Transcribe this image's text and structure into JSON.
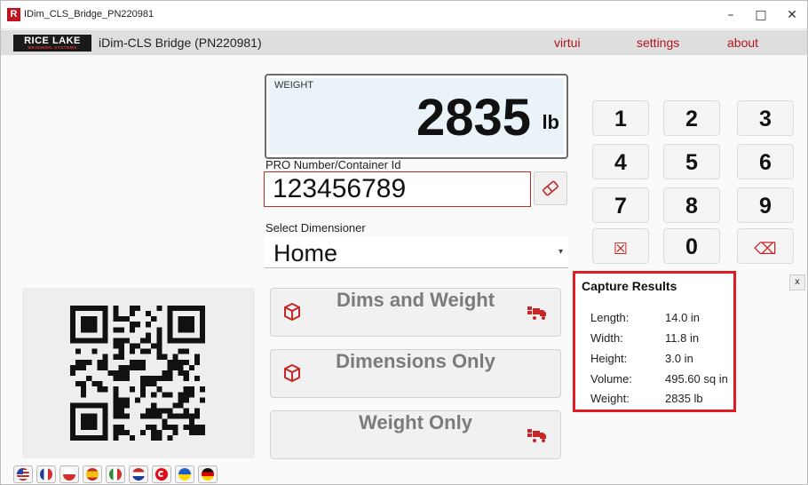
{
  "window": {
    "title": "IDim_CLS_Bridge_PN220981",
    "icon_glyph": "R",
    "controls": {
      "minimize": "–",
      "maximize": "□",
      "close": "✕"
    }
  },
  "header": {
    "brand_top": "RICE LAKE",
    "brand_bottom": "WEIGHING SYSTEMS",
    "title": "iDim-CLS Bridge (PN220981)",
    "menu": [
      "virtui",
      "settings",
      "about"
    ],
    "accent_color": "#b3141c"
  },
  "weight": {
    "label": "WEIGHT",
    "value": "2835",
    "unit": "lb"
  },
  "pro": {
    "label": "PRO Number/Container Id",
    "value": "123456789",
    "clear_icon": "eraser-icon"
  },
  "dimensioner": {
    "label": "Select Dimensioner",
    "value": "Home"
  },
  "actions": [
    {
      "label": "Dims and Weight",
      "left_icon": "box-icon",
      "right_icon": "truck-icon"
    },
    {
      "label": "Dimensions Only",
      "left_icon": "box-icon"
    },
    {
      "label": "Weight Only",
      "right_icon": "truck-icon"
    }
  ],
  "keypad": [
    "1",
    "2",
    "3",
    "4",
    "5",
    "6",
    "7",
    "8",
    "9",
    "☒",
    "0",
    "⌫"
  ],
  "results": {
    "title": "Capture Results",
    "close": "x",
    "rows": [
      {
        "key": "Length:",
        "value": "14.0 in"
      },
      {
        "key": "Width:",
        "value": "11.8 in"
      },
      {
        "key": "Height:",
        "value": "3.0 in"
      },
      {
        "key": "Volume:",
        "value": "495.60 sq in"
      },
      {
        "key": "Weight:",
        "value": "2835 lb"
      }
    ],
    "highlight_color": "#e11d24"
  },
  "languages": [
    "us-flag",
    "france-flag",
    "poland-flag",
    "spain-flag",
    "italy-flag",
    "netherlands-flag",
    "turkey-flag",
    "ukraine-flag",
    "germany-flag"
  ]
}
